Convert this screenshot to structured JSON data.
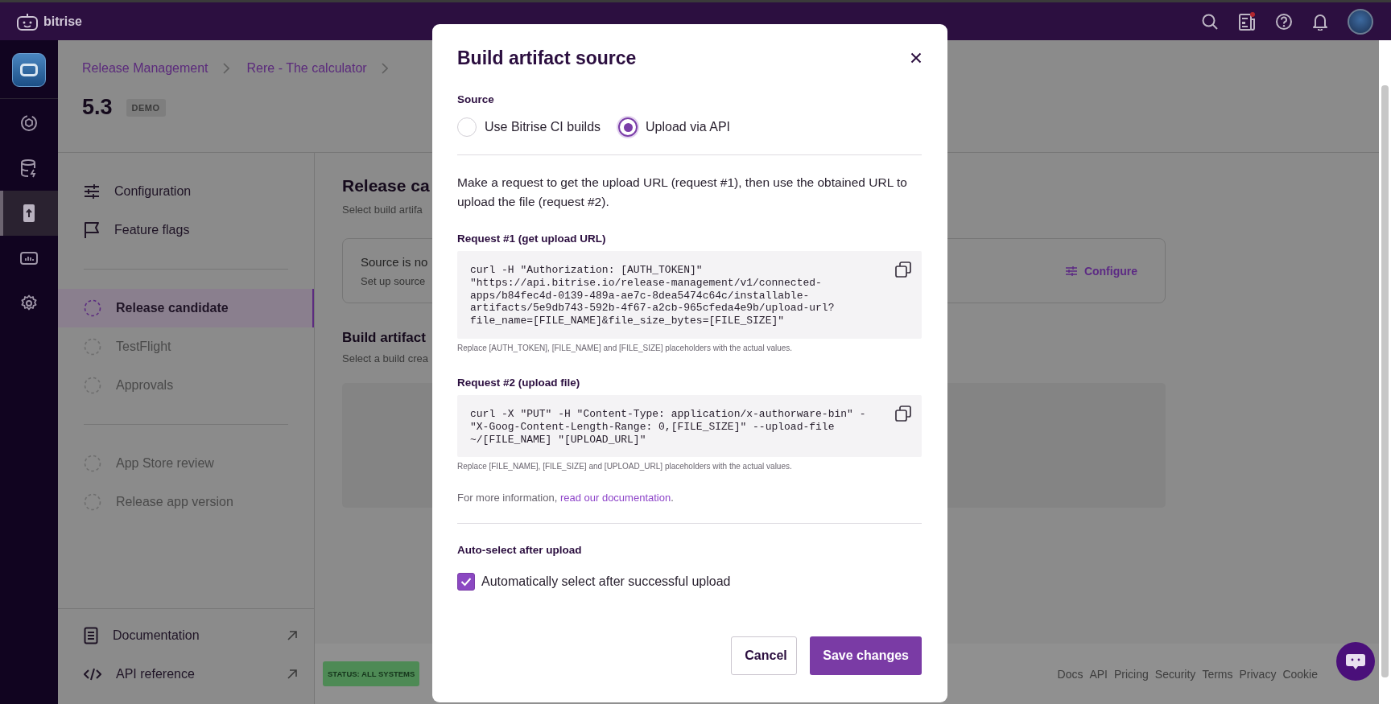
{
  "topbar": {
    "logo": "bitrise"
  },
  "rail": {
    "items": [
      {
        "kind": "ci",
        "selected": false
      },
      {
        "kind": "cache",
        "selected": false
      },
      {
        "kind": "release",
        "selected": true
      },
      {
        "kind": "insights",
        "selected": false
      },
      {
        "kind": "settings",
        "selected": false
      }
    ]
  },
  "header": {
    "breadcrumb": [
      "Release Management",
      "Rere - The calculator"
    ],
    "version": "5.3",
    "badge": "DEMO"
  },
  "subnav": {
    "groups": [
      [
        {
          "label": "Configuration",
          "kind": "sliders",
          "selected": false,
          "disabled": false
        },
        {
          "label": "Feature flags",
          "kind": "flag",
          "selected": false,
          "disabled": false
        }
      ],
      [
        {
          "label": "Release candidate",
          "kind": "step",
          "selected": true,
          "disabled": false
        },
        {
          "label": "TestFlight",
          "kind": "step",
          "selected": false,
          "disabled": true
        },
        {
          "label": "Approvals",
          "kind": "step",
          "selected": false,
          "disabled": true
        }
      ],
      [
        {
          "label": "App Store review",
          "kind": "step",
          "selected": false,
          "disabled": true
        },
        {
          "label": "Release app version",
          "kind": "step",
          "selected": false,
          "disabled": true
        }
      ]
    ],
    "links": [
      {
        "label": "Documentation",
        "kind": "doc"
      },
      {
        "label": "API reference",
        "kind": "code"
      }
    ]
  },
  "content": {
    "title": "Release ca",
    "subtitle": "Select build artifa",
    "card": {
      "title": "Source is no",
      "text": "Set up source",
      "action": "Configure"
    },
    "section_title": "Build artifact",
    "section_subtitle": "Select a build crea"
  },
  "footer": {
    "status": "STATUS: ALL SYSTEMS",
    "links": [
      "Docs",
      "API",
      "Pricing",
      "Security",
      "Terms",
      "Privacy",
      "Cookie"
    ]
  },
  "modal": {
    "title": "Build artifact source",
    "source_label": "Source",
    "options": [
      {
        "label": "Use Bitrise CI builds",
        "selected": false
      },
      {
        "label": "Upload via API",
        "selected": true
      }
    ],
    "intro": "Make a request to get the upload URL (request #1), then use the obtained URL to upload the file (request #2).",
    "requests": [
      {
        "label": "Request #1 (get upload URL)",
        "code": "curl -H \"Authorization: [AUTH_TOKEN]\"\n\"https://api.bitrise.io/release-management/v1/connected-\napps/b84fec4d-0139-489a-ae7c-8dea5474c64c/installable-\nartifacts/5e9db743-592b-4f67-a2cb-965cfeda4e9b/upload-url?\nfile_name=[FILE_NAME]&file_size_bytes=[FILE_SIZE]\"",
        "hint": "Replace [AUTH_TOKEN], [FILE_NAME] and [FILE_SIZE] placeholders with the actual values."
      },
      {
        "label": "Request #2 (upload file)",
        "code": "curl -X \"PUT\" -H \"Content-Type: application/x-authorware-bin\" -\n\"X-Goog-Content-Length-Range: 0,[FILE_SIZE]\" --upload-file\n~/[FILE_NAME] \"[UPLOAD_URL]\"",
        "hint": "Replace [FILE_NAME], [FILE_SIZE] and [UPLOAD_URL] placeholders with the actual values."
      }
    ],
    "more_info": {
      "text": "For more information, ",
      "link": "read our documentation",
      "after": "."
    },
    "auto_select": {
      "label": "Auto-select after upload",
      "checkbox": {
        "label": "Automatically select after successful upload",
        "checked": true
      }
    },
    "buttons": [
      {
        "label": "Cancel",
        "kind": "secondary"
      },
      {
        "label": "Save changes",
        "kind": "primary"
      }
    ]
  }
}
